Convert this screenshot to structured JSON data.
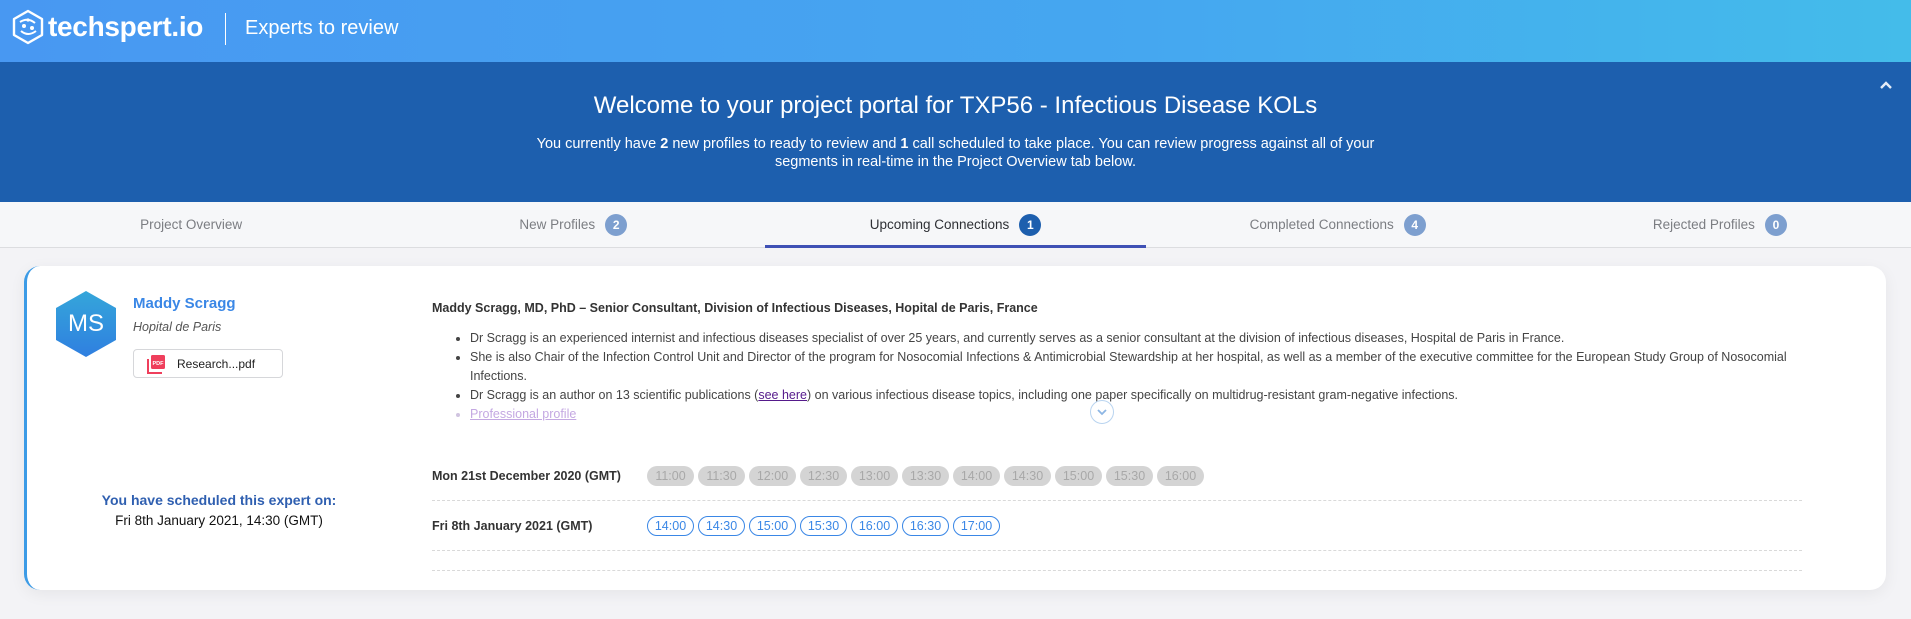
{
  "header": {
    "brand": "techspert.io",
    "logo_icon": "techspert-hex-logo",
    "title": "Experts to review"
  },
  "banner": {
    "title": "Welcome to your project portal for TXP56 - Infectious Disease KOLs",
    "subtitle_parts": {
      "p1": "You currently have ",
      "new_profiles": "2",
      "p2": " new profiles to ready to review and ",
      "calls": "1",
      "p3": " call scheduled to take place. You can review progress against all of your segments in real-time in the Project Overview tab below."
    },
    "collapse_icon": "chevron-up-icon"
  },
  "tabs": [
    {
      "label": "Project Overview",
      "badge": null,
      "active": false
    },
    {
      "label": "New Profiles",
      "badge": "2",
      "active": false
    },
    {
      "label": "Upcoming Connections",
      "badge": "1",
      "active": true
    },
    {
      "label": "Completed Connections",
      "badge": "4",
      "active": false
    },
    {
      "label": "Rejected Profiles",
      "badge": "0",
      "active": false
    }
  ],
  "expert": {
    "initials": "MS",
    "name": "Maddy Scragg",
    "organization": "Hopital de Paris",
    "attachment": {
      "icon": "pdf-icon",
      "filename": "Research...pdf"
    },
    "scheduled_label": "You have scheduled this expert on:",
    "scheduled_value": "Fri 8th January 2021, 14:30 (GMT)",
    "bio": {
      "title": "Maddy Scragg, MD, PhD – Senior Consultant, Division of Infectious Diseases, Hopital de Paris, France",
      "bullets": {
        "b1": "Dr Scragg is an experienced internist and infectious diseases specialist of over 25 years, and currently serves as a senior consultant at the division of infectious diseases, Hospital de Paris in France.",
        "b2": "She is also Chair of the Infection Control Unit and Director of the program for Nosocomial Infections & Antimicrobial Stewardship at her hospital, as well as a member of the executive committee for the European Study Group of Nosocomial Infections.",
        "b3_pre": "Dr Scragg is an author on 13 scientific publications (",
        "b3_link": "see here",
        "b3_post": ") on various infectious disease topics, including one paper specifically on multidrug-resistant gram-negative infections.",
        "b4_link": "Professional profile"
      },
      "expand_icon": "chevron-down-icon"
    },
    "availability": [
      {
        "date": "Mon 21st December 2020 (GMT)",
        "state": "disabled",
        "slots": [
          "11:00",
          "11:30",
          "12:00",
          "12:30",
          "13:00",
          "13:30",
          "14:00",
          "14:30",
          "15:00",
          "15:30",
          "16:00"
        ]
      },
      {
        "date": "Fri 8th January 2021 (GMT)",
        "state": "available",
        "slots": [
          "14:00",
          "14:30",
          "15:00",
          "15:30",
          "16:00",
          "16:30",
          "17:00"
        ]
      }
    ]
  },
  "colors": {
    "header_gradient_start": "#4898f2",
    "header_gradient_end": "#44bcea",
    "banner": "#1d5fae",
    "accent": "#3a87e6",
    "tab_active_underline": "#3f51b5",
    "badge": "#7d9fcf"
  }
}
